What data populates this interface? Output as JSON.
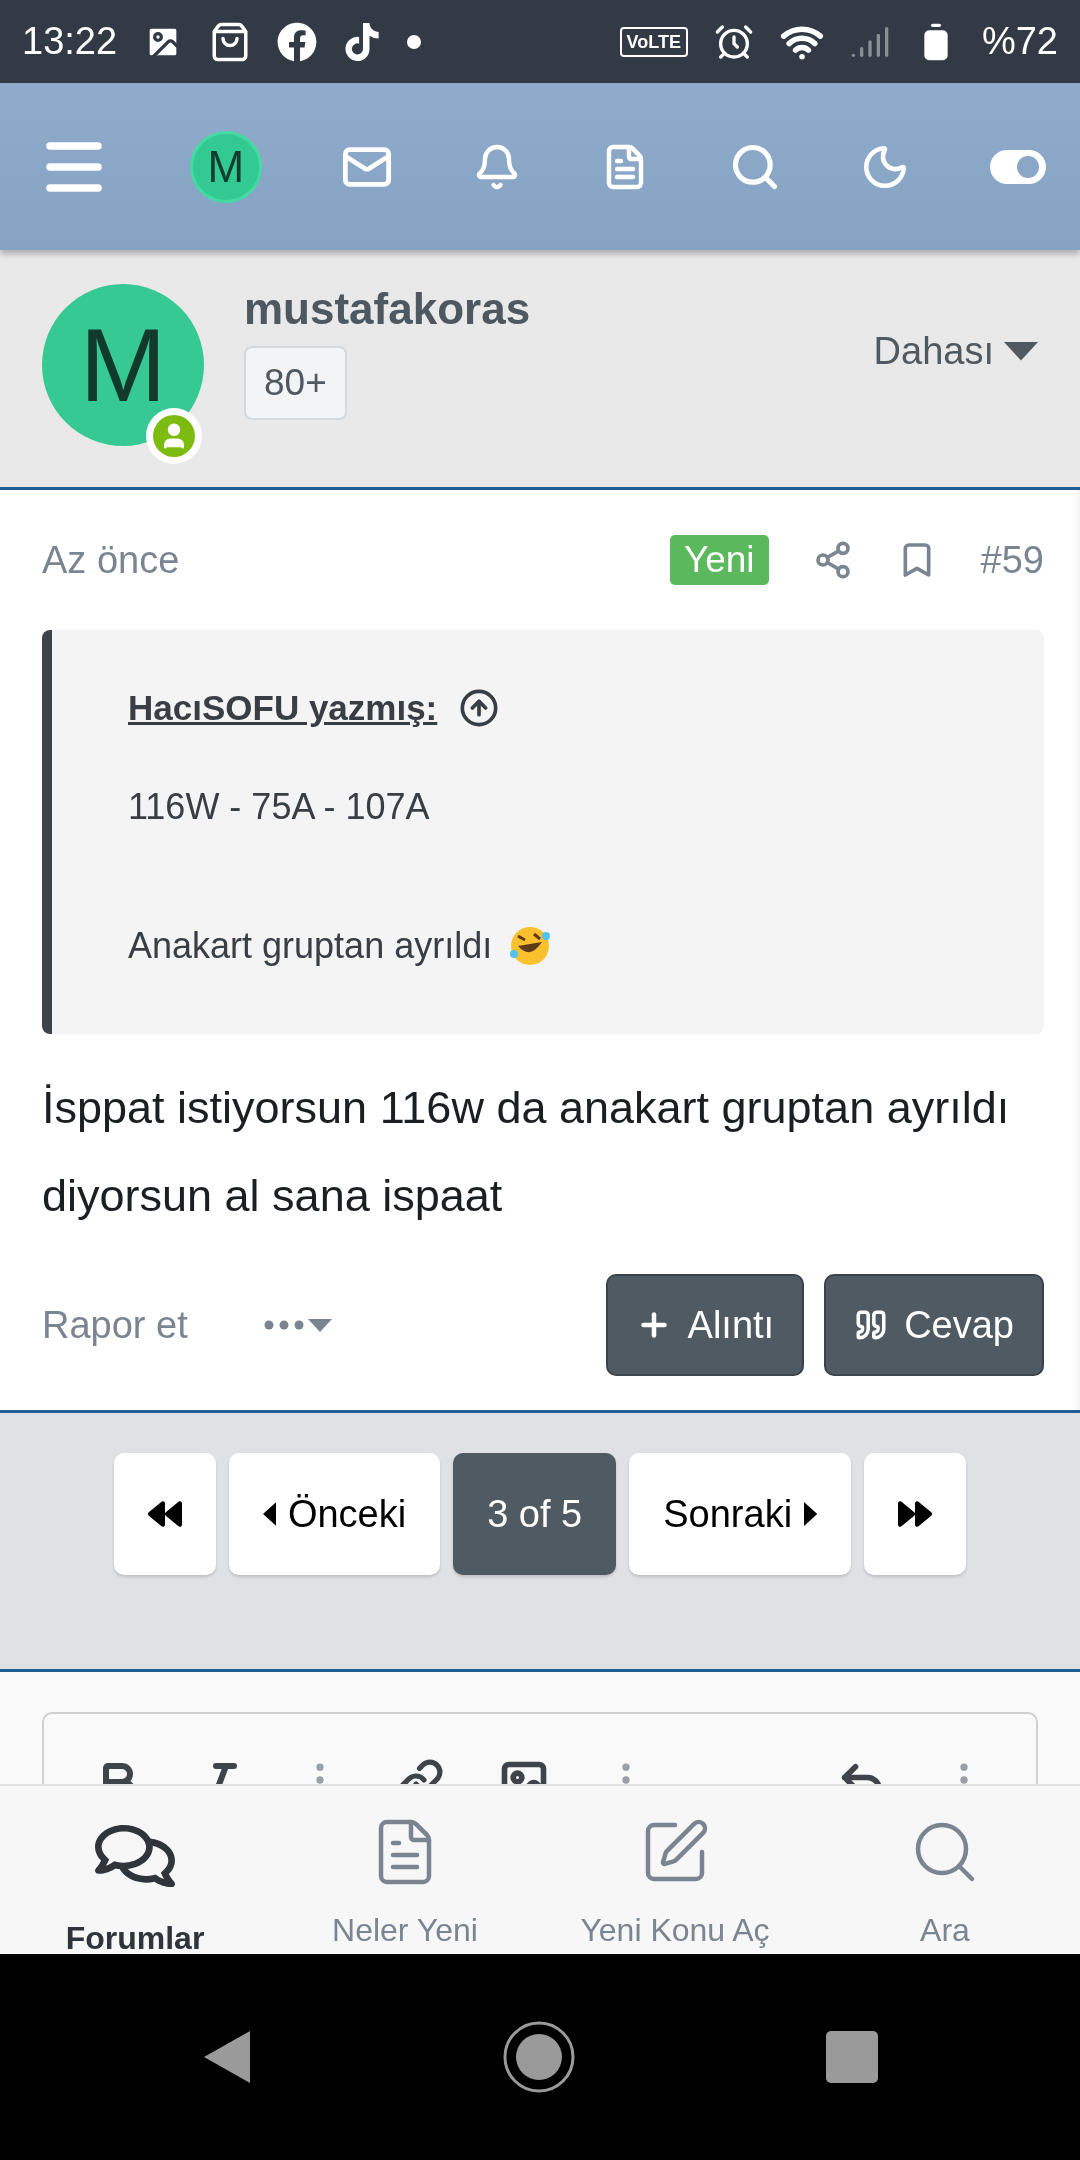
{
  "status_bar": {
    "time": "13:22",
    "network": "VoLTE",
    "battery": "%72"
  },
  "header": {
    "avatar_letter": "M"
  },
  "profile": {
    "avatar_letter": "M",
    "username": "mustafakoras",
    "badge": "80+",
    "more": "Dahası"
  },
  "post": {
    "time": "Az önce",
    "badge": "Yeni",
    "number": "#59",
    "quote": {
      "author": "HacıSOFU yazmış:",
      "lines": [
        "116W - 75A - 107A",
        "Anakart gruptan ayrıldı"
      ]
    },
    "body": "İsppat istiyorsun 116w da anakart gruptan ayrıldı diyorsun al sana ispaat",
    "report": "Rapor et",
    "buttons": [
      {
        "kind": "quote",
        "label": "Alıntı"
      },
      {
        "kind": "reply",
        "label": "Cevap"
      }
    ]
  },
  "pagination": [
    {
      "kind": "first",
      "selected": false
    },
    {
      "kind": "prev",
      "label": "Önceki",
      "selected": false
    },
    {
      "kind": "page",
      "label": "3 of 5",
      "selected": true
    },
    {
      "kind": "next",
      "label": "Sonraki",
      "selected": false
    },
    {
      "kind": "last",
      "selected": false
    }
  ],
  "bottom_nav": [
    {
      "kind": "forums",
      "label": "Forumlar",
      "selected": true
    },
    {
      "kind": "new",
      "label": "Neler Yeni",
      "selected": false
    },
    {
      "kind": "compose",
      "label": "Yeni Konu Aç",
      "selected": false
    },
    {
      "kind": "search",
      "label": "Ara",
      "selected": false
    }
  ]
}
